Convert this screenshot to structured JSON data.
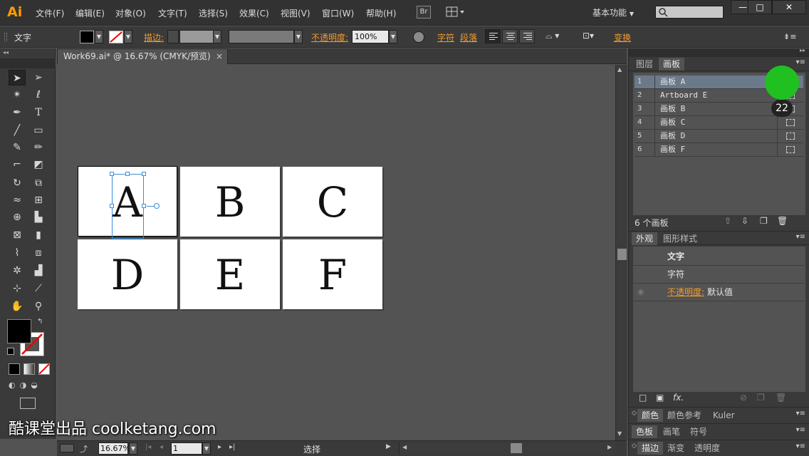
{
  "app": {
    "logo": "Ai",
    "menu": [
      "文件(F)",
      "编辑(E)",
      "对象(O)",
      "文字(T)",
      "选择(S)",
      "效果(C)",
      "视图(V)",
      "窗口(W)",
      "帮助(H)"
    ],
    "bridge_label": "Br",
    "workspace": "基本功能",
    "window_buttons": [
      "—",
      "□",
      "✕"
    ]
  },
  "control_bar": {
    "label": "文字",
    "stroke_label": "描边:",
    "opacity_label": "不透明度:",
    "opacity_value": "100%",
    "character_label": "字符",
    "paragraph_label": "段落",
    "transform_label": "变换"
  },
  "document": {
    "tab_title": "Work69.ai* @ 16.67% (CMYK/预览)",
    "close": "×"
  },
  "artboards": [
    {
      "letter": "A"
    },
    {
      "letter": "B"
    },
    {
      "letter": "C"
    },
    {
      "letter": "D"
    },
    {
      "letter": "E"
    },
    {
      "letter": "F"
    }
  ],
  "artboards_panel": {
    "tabs": [
      "图层",
      "画板"
    ],
    "rows": [
      {
        "num": "1",
        "name": "画板 A"
      },
      {
        "num": "2",
        "name": "Artboard E"
      },
      {
        "num": "3",
        "name": "画板 B"
      },
      {
        "num": "4",
        "name": "画板 C"
      },
      {
        "num": "5",
        "name": "画板 D"
      },
      {
        "num": "6",
        "name": "画板 F"
      }
    ],
    "count": "6 个画板",
    "badge": "22"
  },
  "appearance_panel": {
    "tabs": [
      "外观",
      "图形样式"
    ],
    "rows": [
      "文字",
      "字符"
    ],
    "opacity_label": "不透明度:",
    "opacity_value": "默认值"
  },
  "bottom_panels": [
    [
      "颜色",
      "颜色参考",
      "Kuler"
    ],
    [
      "色板",
      "画笔",
      "符号"
    ],
    [
      "描边",
      "渐变",
      "透明度"
    ]
  ],
  "status_bar": {
    "zoom": "16.67%",
    "page": "1",
    "tool": "选择"
  },
  "watermark": "酷课堂出品 coolketang.com"
}
